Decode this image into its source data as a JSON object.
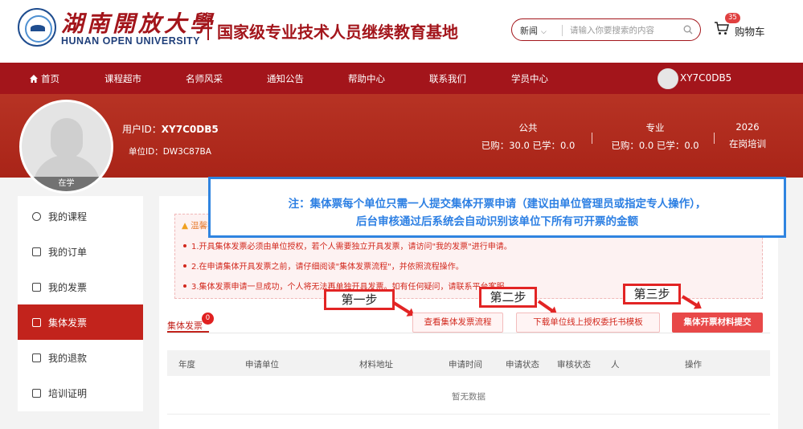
{
  "header": {
    "logo_cn": "湖南開放大學",
    "logo_en": "HUNAN OPEN UNIVERSITY",
    "subtitle": "国家级专业技术人员继续教育基地",
    "search": {
      "scope": "新闻",
      "placeholder": "请输入你要搜索的内容"
    },
    "cart": {
      "label": "购物车",
      "count": "35"
    }
  },
  "nav": {
    "items": [
      "首页",
      "课程超市",
      "名师风采",
      "通知公告",
      "帮助中心",
      "联系我们",
      "学员中心"
    ],
    "username": "XY7C0DB5"
  },
  "profile": {
    "status": "在学",
    "user_id_label": "用户ID：",
    "user_id": "XY7C0DB5",
    "unit_id_label": "单位ID：",
    "unit_id": "DW3C87BA",
    "stats": [
      {
        "title": "公共",
        "value": "已购：30.0 已学：0.0"
      },
      {
        "title": "专业",
        "value": "已购：0.0 已学：0.0"
      },
      {
        "title": "2026",
        "value": "在岗培训"
      }
    ]
  },
  "sidebar": {
    "items": [
      {
        "label": "我的课程",
        "icon": "play-circle-icon",
        "active": false
      },
      {
        "label": "我的订单",
        "icon": "document-icon",
        "active": false
      },
      {
        "label": "我的发票",
        "icon": "invoice-icon",
        "active": false
      },
      {
        "label": "集体发票",
        "icon": "invoice-icon",
        "active": true
      },
      {
        "label": "我的退款",
        "icon": "refund-icon",
        "active": false
      },
      {
        "label": "培训证明",
        "icon": "certificate-icon",
        "active": false
      }
    ]
  },
  "tips": {
    "title": "温馨提示",
    "items": [
      "1.开具集体发票必须由单位授权，若个人需要独立开具发票，请访问\"我的发票\"进行申请。",
      "2.在申请集体开具发票之前，请仔细阅读\"集体发票流程\"，并依照流程操作。",
      "3.集体发票申请一旦成功，个人将无法再单独开具发票。如有任何疑问，请联系平台客服。"
    ]
  },
  "note": {
    "line1": "注：集体票每个单位只需一人提交集体开票申请（建议由单位管理员或指定专人操作），",
    "line2": "后台审核通过后系统会自动识别该单位下所有可开票的金额"
  },
  "steps": [
    "第一步",
    "第二步",
    "第三步"
  ],
  "tab": {
    "label": "集体发票",
    "badge": "0"
  },
  "buttons": {
    "flow": "查看集体发票流程",
    "download": "下载单位线上授权委托书模板",
    "submit": "集体开票材料提交"
  },
  "table": {
    "columns": [
      "年度",
      "申请单位",
      "材料地址",
      "申请时间",
      "申请状态",
      "审核状态",
      "人",
      "操作"
    ],
    "empty_text": "暂无数据"
  },
  "colors": {
    "brand_red": "#a3151b",
    "band_red": "#b22a1e",
    "note_blue": "#2c7fe3",
    "step_red": "#e22424"
  }
}
